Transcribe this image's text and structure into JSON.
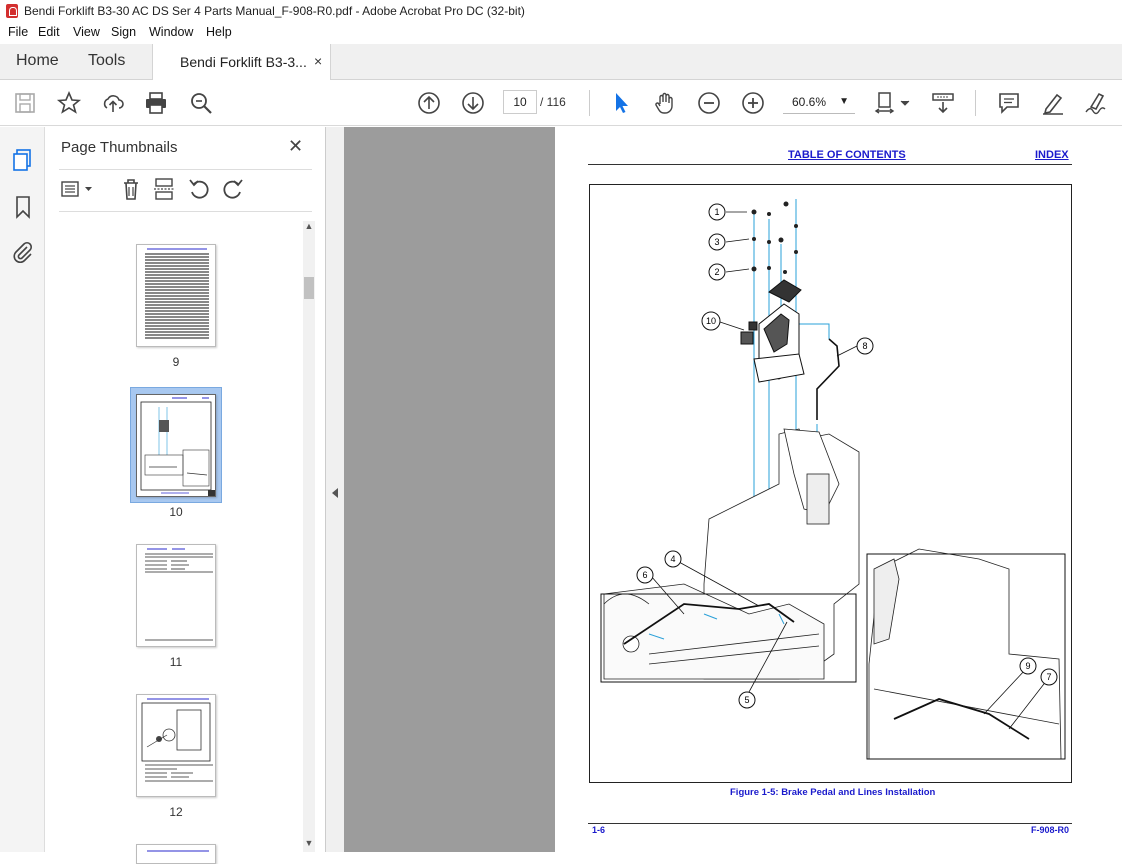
{
  "window": {
    "title": "Bendi Forklift B3-30 AC DS  Ser 4 Parts Manual_F-908-R0.pdf - Adobe Acrobat Pro DC (32-bit)"
  },
  "menu": [
    "File",
    "Edit",
    "View",
    "Sign",
    "Window",
    "Help"
  ],
  "tabs": {
    "home": "Home",
    "tools": "Tools",
    "document": "Bendi Forklift B3-3...",
    "close": "×"
  },
  "toolbar": {
    "current_page": "10",
    "page_total": "/  116",
    "zoom": "60.6%"
  },
  "panel": {
    "title": "Page Thumbnails",
    "close": "✕",
    "thumbnails": [
      {
        "page": "9",
        "selected": false
      },
      {
        "page": "10",
        "selected": true
      },
      {
        "page": "11",
        "selected": false
      },
      {
        "page": "12",
        "selected": false
      }
    ]
  },
  "document": {
    "toc_link": "TABLE OF CONTENTS",
    "index_link": "INDEX",
    "figure_caption": "Figure 1-5:  Brake Pedal and Lines Installation",
    "footer_left": "1-6",
    "footer_right": "F-908-R0",
    "callouts": [
      "1",
      "3",
      "2",
      "10",
      "8",
      "6",
      "4",
      "5",
      "9",
      "7"
    ]
  },
  "colors": {
    "link_blue": "#1a1acc",
    "doc_background": "#9c9c9c",
    "selected_thumb": "#a8c8f0",
    "leader_cyan": "#2aa0d8"
  }
}
